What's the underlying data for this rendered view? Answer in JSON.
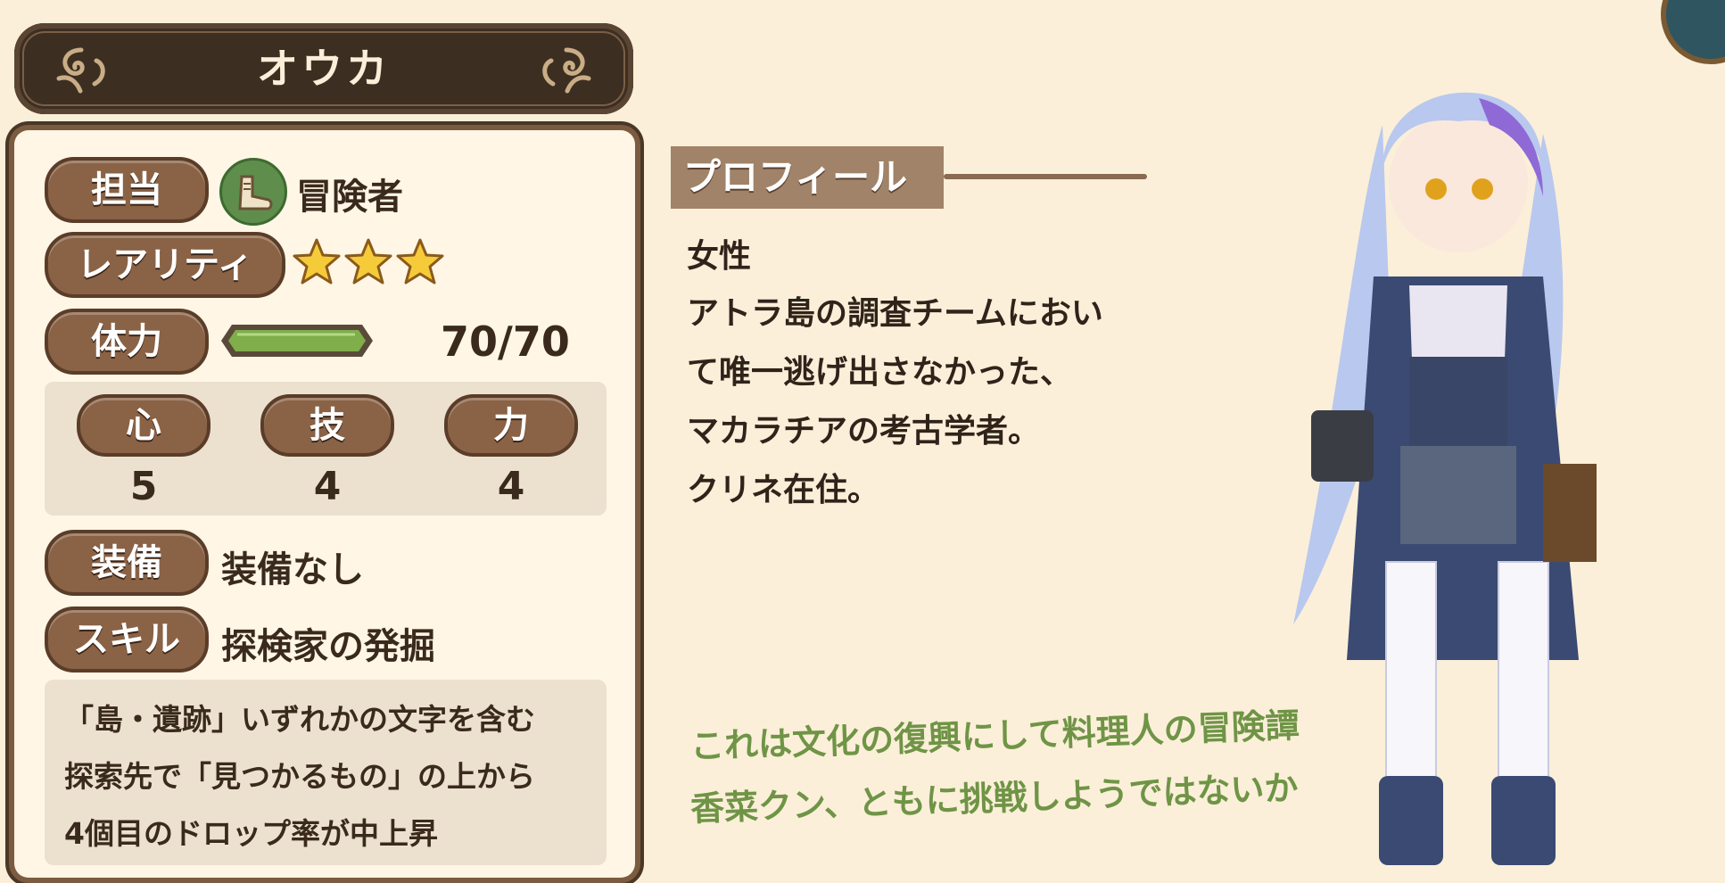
{
  "header": {
    "name": "オウカ"
  },
  "stats": {
    "role_label": "担当",
    "role_value": "冒険者",
    "role_icon": "boot-icon",
    "rarity_label": "レアリティ",
    "rarity_stars": 3,
    "hp_label": "体力",
    "hp_value": "70/70",
    "hp_fraction": 1.0,
    "attributes": [
      {
        "label": "心",
        "value": "5"
      },
      {
        "label": "技",
        "value": "4"
      },
      {
        "label": "力",
        "value": "4"
      }
    ],
    "equip_label": "装備",
    "equip_value": "装備なし",
    "skill_label": "スキル",
    "skill_value": "探検家の発掘",
    "skill_desc": [
      "「島・遺跡」いずれかの文字を含む",
      "探索先で「見つかるもの」の上から",
      "4個目のドロップ率が中上昇"
    ]
  },
  "profile": {
    "heading": "プロフィール",
    "lines": [
      "女性",
      "アトラ島の調査チームにおい",
      "て唯一逃げ出さなかった、",
      "マカラチアの考古学者。",
      "クリネ在住。"
    ]
  },
  "catchphrase": [
    "これは文化の復興にして料理人の冒険譚",
    "香菜クン、ともに挑戦しようではないか"
  ],
  "colors": {
    "background": "#fbefd9",
    "banner": "#3d2e22",
    "pill": "#8a6245",
    "hp_bar": "#7fae4a",
    "catch_text": "#6f9446"
  }
}
